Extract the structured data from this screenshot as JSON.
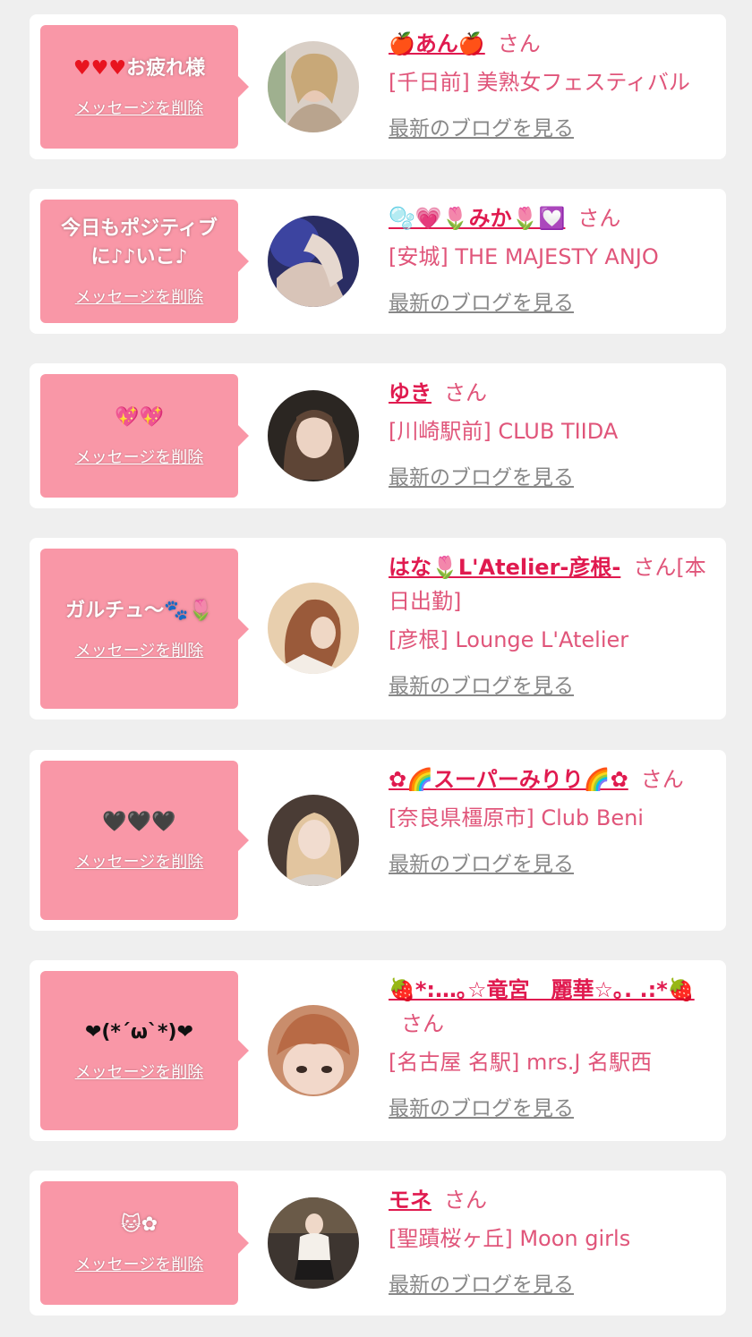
{
  "delete_label": "メッセージを削除",
  "blog_label": "最新のブログを見る",
  "accent": "#f997a7",
  "name_color": "#e01a4f",
  "entries": [
    {
      "message": "お疲れ様",
      "message_prefix": "♥♥♥",
      "name": "🍎あん🍎",
      "honorific": "さん",
      "shop": "[千日前] 美熟女フェスティバル"
    },
    {
      "message": "今日もポジティブ\nに♪♪いこ♪",
      "name": "🫧💗🌷みか🌷💟",
      "honorific": "さん",
      "shop": "[安城] THE MAJESTY ANJO"
    },
    {
      "message": "💖💖",
      "name": "ゆき",
      "honorific": "さん",
      "shop": "[川崎駅前] CLUB TIIDA"
    },
    {
      "message": "ガルチュ〜🐾🌷",
      "name": "はな🌷L'Atelier-彦根-",
      "honorific": "さん[本日出勤]",
      "shop": "[彦根] Lounge L'Atelier"
    },
    {
      "message": "🖤🖤🖤",
      "name": "✿🌈スーパーみりり🌈✿",
      "honorific": "さん",
      "shop": "[奈良県橿原市] Club Beni"
    },
    {
      "message": "❤(*´ω`*)❤",
      "name": "🍓*:…｡☆竜宮　麗華☆｡. .:*🍓",
      "honorific": "さん",
      "shop": "[名古屋 名駅] mrs.J 名駅西"
    },
    {
      "message": "🐱✿",
      "name": "モネ",
      "honorific": "さん",
      "shop": "[聖蹟桜ヶ丘] Moon girls"
    }
  ]
}
